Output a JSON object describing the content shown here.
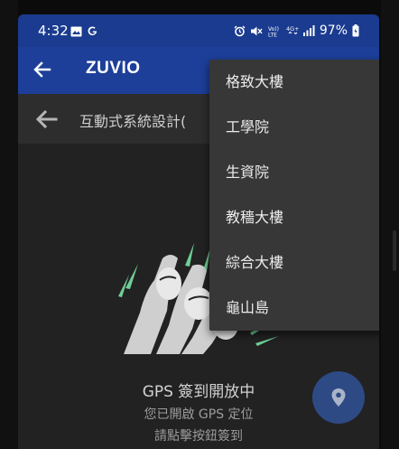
{
  "status_bar": {
    "time": "4:32",
    "left_icons": [
      "image-icon",
      "google-g-icon"
    ],
    "right_icons": [
      "alarm-icon",
      "mute-icon",
      "volte-icon",
      "4g-icon",
      "signal-icon",
      "battery-icon"
    ],
    "volte_label": "Vo))\nLTE",
    "network_label": "4G+",
    "battery": "97%"
  },
  "app_bar": {
    "title": "ZUVIO",
    "back_icon": "arrow-left-icon"
  },
  "sub_bar": {
    "title": "互動式系統設計(",
    "back_icon": "arrow-left-icon"
  },
  "content": {
    "illustration": "raised-hands-illustration",
    "gps_title": "GPS 簽到開放中",
    "gps_line1": "您已開啟 GPS 定位",
    "gps_line2": "請點擊按鈕簽到"
  },
  "fab": {
    "icon": "location-pin-icon"
  },
  "dropdown": {
    "items": [
      "格致大樓",
      "工學院",
      "生資院",
      "教穡大樓",
      "綜合大樓",
      "龜山島"
    ]
  },
  "colors": {
    "status_bar": "#1a3b8f",
    "app_bar": "#1d3f99",
    "menu_bg": "#373737",
    "fab_bg": "#2e4a85",
    "accent_green": "#6fcf97"
  }
}
